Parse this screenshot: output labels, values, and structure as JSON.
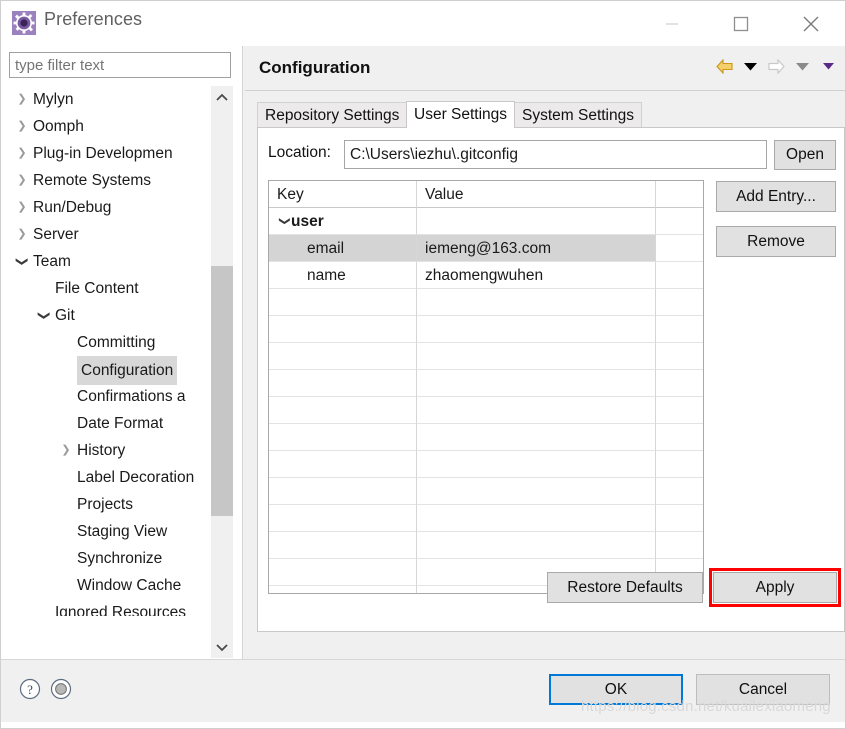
{
  "window": {
    "title": "Preferences",
    "icon": "preferences-gear-icon",
    "accent_blue": "#0078d7",
    "highlight_red": "#ff0000",
    "controls": {
      "minimize": "minimize-icon",
      "maximize": "maximize-icon",
      "close": "close-icon"
    }
  },
  "sidebar": {
    "filter": {
      "value": "",
      "placeholder": "type filter text"
    },
    "items": [
      {
        "label": "Mylyn",
        "indent": 0,
        "twisty": "collapsed",
        "selected": false
      },
      {
        "label": "Oomph",
        "indent": 0,
        "twisty": "collapsed",
        "selected": false
      },
      {
        "label": "Plug-in Developmen",
        "indent": 0,
        "twisty": "collapsed",
        "selected": false
      },
      {
        "label": "Remote Systems",
        "indent": 0,
        "twisty": "collapsed",
        "selected": false
      },
      {
        "label": "Run/Debug",
        "indent": 0,
        "twisty": "collapsed",
        "selected": false
      },
      {
        "label": "Server",
        "indent": 0,
        "twisty": "collapsed",
        "selected": false
      },
      {
        "label": "Team",
        "indent": 0,
        "twisty": "expanded",
        "selected": false
      },
      {
        "label": "File Content",
        "indent": 1,
        "twisty": "none",
        "selected": false
      },
      {
        "label": "Git",
        "indent": 1,
        "twisty": "expanded",
        "selected": false
      },
      {
        "label": "Committing",
        "indent": 2,
        "twisty": "none",
        "selected": false
      },
      {
        "label": "Configuration",
        "indent": 2,
        "twisty": "none",
        "selected": true
      },
      {
        "label": "Confirmations a",
        "indent": 2,
        "twisty": "none",
        "selected": false
      },
      {
        "label": "Date Format",
        "indent": 2,
        "twisty": "none",
        "selected": false
      },
      {
        "label": "History",
        "indent": 2,
        "twisty": "collapsed",
        "selected": false
      },
      {
        "label": "Label Decoration",
        "indent": 2,
        "twisty": "none",
        "selected": false
      },
      {
        "label": "Projects",
        "indent": 2,
        "twisty": "none",
        "selected": false
      },
      {
        "label": "Staging View",
        "indent": 2,
        "twisty": "none",
        "selected": false
      },
      {
        "label": "Synchronize",
        "indent": 2,
        "twisty": "none",
        "selected": false
      },
      {
        "label": "Window Cache",
        "indent": 2,
        "twisty": "none",
        "selected": false
      },
      {
        "label": "Ignored Resources",
        "indent": 1,
        "twisty": "none",
        "selected": false
      }
    ],
    "scrollbars": {
      "vertical_up": "chevron-up-icon",
      "vertical_down": "chevron-down-icon",
      "horizontal_left": "chevron-left-icon",
      "horizontal_right": "chevron-right-icon"
    }
  },
  "main": {
    "title": "Configuration",
    "nav": [
      {
        "name": "back-arrow-icon",
        "glyph": "back",
        "color": "#e8a93a"
      },
      {
        "name": "back-dropdown-icon",
        "glyph": "caret",
        "color": "#000000"
      },
      {
        "name": "forward-arrow-icon",
        "glyph": "forward",
        "color": "#c4c4c4"
      },
      {
        "name": "forward-dropdown-icon",
        "glyph": "caret",
        "color": "#8a8a8a"
      },
      {
        "name": "menu-dropdown-icon",
        "glyph": "caret",
        "color": "#5b2a86"
      }
    ],
    "tabs": [
      {
        "label": "Repository Settings",
        "active": false
      },
      {
        "label": "User Settings",
        "active": true
      },
      {
        "label": "System Settings",
        "active": false
      }
    ],
    "location": {
      "label": "Location:",
      "value": "C:\\Users\\iezhu\\.gitconfig",
      "placeholder": "",
      "open_button": "Open"
    },
    "table": {
      "columns": [
        "Key",
        "Value",
        ""
      ],
      "rows": [
        {
          "key": "user",
          "value": "",
          "level": 0,
          "twisty": "expanded",
          "bold": true,
          "selected": false
        },
        {
          "key": "email",
          "value": "iemeng@163.com",
          "level": 1,
          "twisty": "none",
          "bold": false,
          "selected": true
        },
        {
          "key": "name",
          "value": "zhaomengwuhen",
          "level": 1,
          "twisty": "none",
          "bold": false,
          "selected": false
        }
      ],
      "empty_row_count": 12
    },
    "side_buttons": {
      "add_entry": "Add Entry...",
      "remove": "Remove"
    },
    "bottom_buttons": {
      "restore_defaults": "Restore Defaults",
      "apply": "Apply",
      "apply_highlighted": true
    }
  },
  "footer": {
    "help_icon": "help-question-icon",
    "shell_icon": "shell-circle-icon",
    "ok": "OK",
    "cancel": "Cancel",
    "watermark": "https://blog.csdn.net/kuailexiaomeng"
  }
}
